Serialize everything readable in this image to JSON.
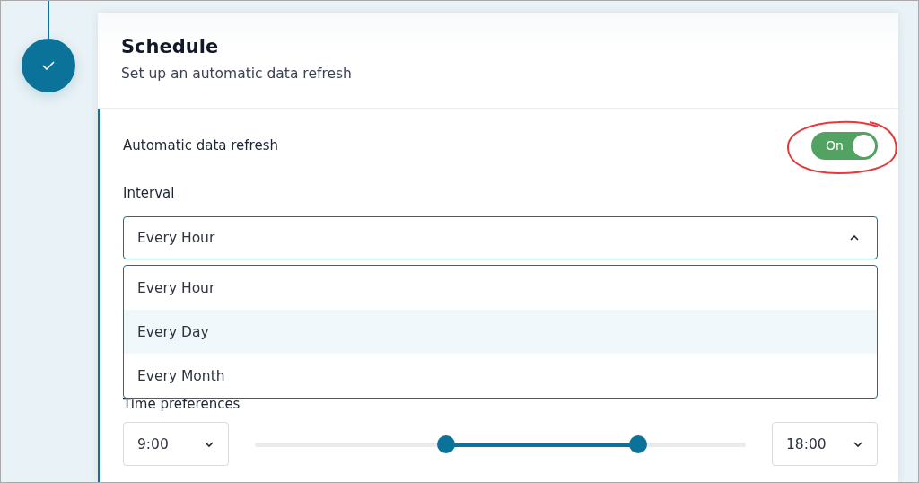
{
  "step": {
    "completed": true
  },
  "card": {
    "title": "Schedule",
    "subtitle": "Set up an automatic data refresh"
  },
  "auto_refresh": {
    "label": "Automatic data refresh",
    "toggle": {
      "on": true,
      "label": "On"
    },
    "annotation": {
      "kind": "circle",
      "color": "#e8383b"
    }
  },
  "interval": {
    "label": "Interval",
    "value": "Every Hour",
    "expanded": true,
    "options": [
      {
        "label": "Every Hour",
        "highlighted": false
      },
      {
        "label": "Every Day",
        "highlighted": true
      },
      {
        "label": "Every Month",
        "highlighted": false
      }
    ]
  },
  "time_preferences": {
    "label": "Time preferences",
    "start": "9:00",
    "end": "18:00",
    "thumbs": [
      {
        "level": 0.39
      },
      {
        "level": 0.78
      }
    ]
  }
}
